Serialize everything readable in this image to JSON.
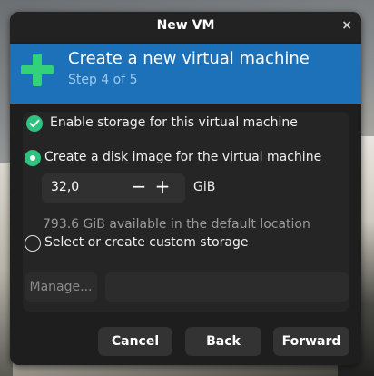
{
  "window": {
    "title": "New VM",
    "close_glyph": "×"
  },
  "banner": {
    "icon": "plus-icon",
    "heading": "Create a new virtual machine",
    "step": "Step 4 of 5",
    "accent_color": "#1c71b8",
    "icon_color": "#33d17a"
  },
  "storage": {
    "enable_label": "Enable storage for this virtual machine",
    "enable_checked": true,
    "create_disk_label": "Create a disk image for the virtual machine",
    "create_disk_selected": true,
    "size_value": "32,0",
    "size_unit": "GiB",
    "decrement_glyph": "−",
    "increment_glyph": "+",
    "available_text": "793.6 GiB available in the default location",
    "custom_label": "Select or create custom storage",
    "custom_selected": false,
    "manage_label": "Manage...",
    "custom_path_value": ""
  },
  "footer": {
    "cancel_label": "Cancel",
    "back_label": "Back",
    "forward_label": "Forward"
  },
  "colors": {
    "check_green": "#2ec27e",
    "window_bg": "#1e1e1e"
  }
}
